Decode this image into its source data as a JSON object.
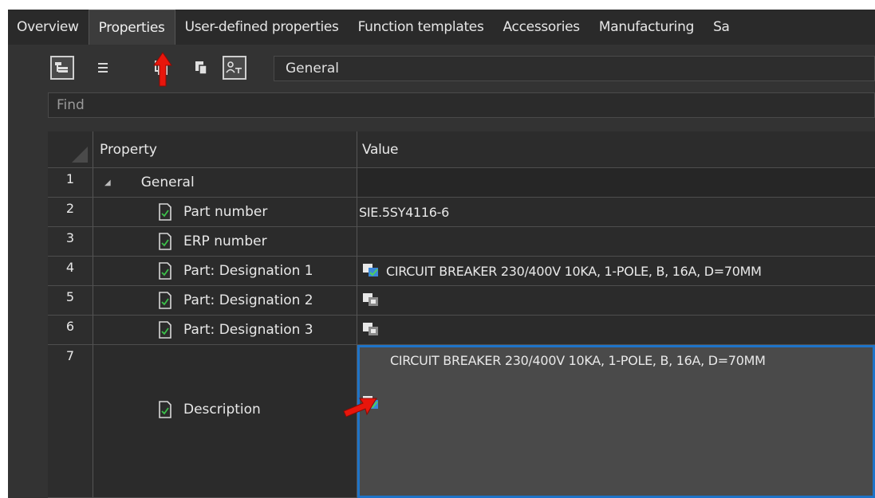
{
  "tabs": [
    {
      "label": "Overview"
    },
    {
      "label": "Properties"
    },
    {
      "label": "User-defined properties"
    },
    {
      "label": "Function templates"
    },
    {
      "label": "Accessories"
    },
    {
      "label": "Manufacturing"
    },
    {
      "label": "Sa"
    }
  ],
  "toolbar": {
    "filter_value": "General",
    "icons": [
      "tree-view-icon",
      "list-view-icon",
      "copy-icon",
      "paste-icon",
      "user-filter-icon"
    ]
  },
  "find": {
    "placeholder": "Find"
  },
  "grid": {
    "headers": {
      "property": "Property",
      "value": "Value"
    },
    "rows": [
      {
        "num": "1",
        "property": "General",
        "value": ""
      },
      {
        "num": "2",
        "property": "Part number",
        "value": "SIE.5SY4116-6"
      },
      {
        "num": "3",
        "property": "ERP number",
        "value": ""
      },
      {
        "num": "4",
        "property": "Part: Designation 1",
        "value": "CIRCUIT BREAKER 230/400V 10KA, 1-POLE, B, 16A, D=70MM"
      },
      {
        "num": "5",
        "property": "Part: Designation 2",
        "value": ""
      },
      {
        "num": "6",
        "property": "Part: Designation 3",
        "value": ""
      },
      {
        "num": "7",
        "property": "Description",
        "value": "CIRCUIT BREAKER 230/400V 10KA, 1-POLE, B, 16A, D=70MM"
      }
    ]
  },
  "colors": {
    "background": "#383838",
    "selection_border": "#1e73c8",
    "annotation_arrow": "#e8160c"
  }
}
